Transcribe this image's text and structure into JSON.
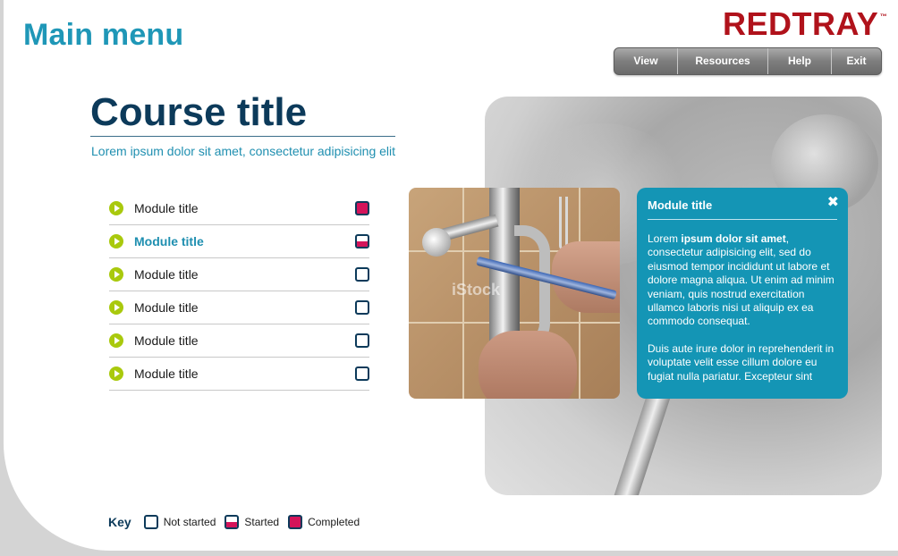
{
  "header": {
    "main_menu": "Main menu",
    "logo": "REDTRAY",
    "logo_tm": "™",
    "nav": [
      "View",
      "Resources",
      "Help",
      "Exit"
    ]
  },
  "course": {
    "title": "Course title",
    "subtitle": "Lorem ipsum dolor sit amet, consectetur adipisicing elit"
  },
  "modules": [
    {
      "label": "Module title",
      "status": "completed",
      "active": false
    },
    {
      "label": "Module title",
      "status": "started",
      "active": true
    },
    {
      "label": "Module title",
      "status": "not_started",
      "active": false
    },
    {
      "label": "Module title",
      "status": "not_started",
      "active": false
    },
    {
      "label": "Module title",
      "status": "not_started",
      "active": false
    },
    {
      "label": "Module title",
      "status": "not_started",
      "active": false
    }
  ],
  "photo": {
    "watermark": "iStock"
  },
  "info_panel": {
    "title": "Module title",
    "close_glyph": "✖",
    "para1_lead": "Lorem ",
    "para1_bold": "ipsum dolor sit amet",
    "para1_rest": ", consectetur adipisicing elit, sed do eiusmod tempor incididunt ut labore et dolore magna aliqua. Ut enim ad minim veniam, quis nostrud exercitation ullamco laboris nisi ut aliquip ex ea commodo consequat.",
    "para2": "Duis aute irure dolor in reprehenderit in voluptate velit esse cillum dolore eu fugiat nulla pariatur. Excepteur sint"
  },
  "key": {
    "label": "Key",
    "not_started": "Not started",
    "started": "Started",
    "completed": "Completed"
  },
  "colors": {
    "accent_teal": "#1f97b7",
    "navy": "#0c3a5a",
    "magenta": "#d4145a",
    "lime": "#a9c90d",
    "brand_red": "#b0121b"
  }
}
